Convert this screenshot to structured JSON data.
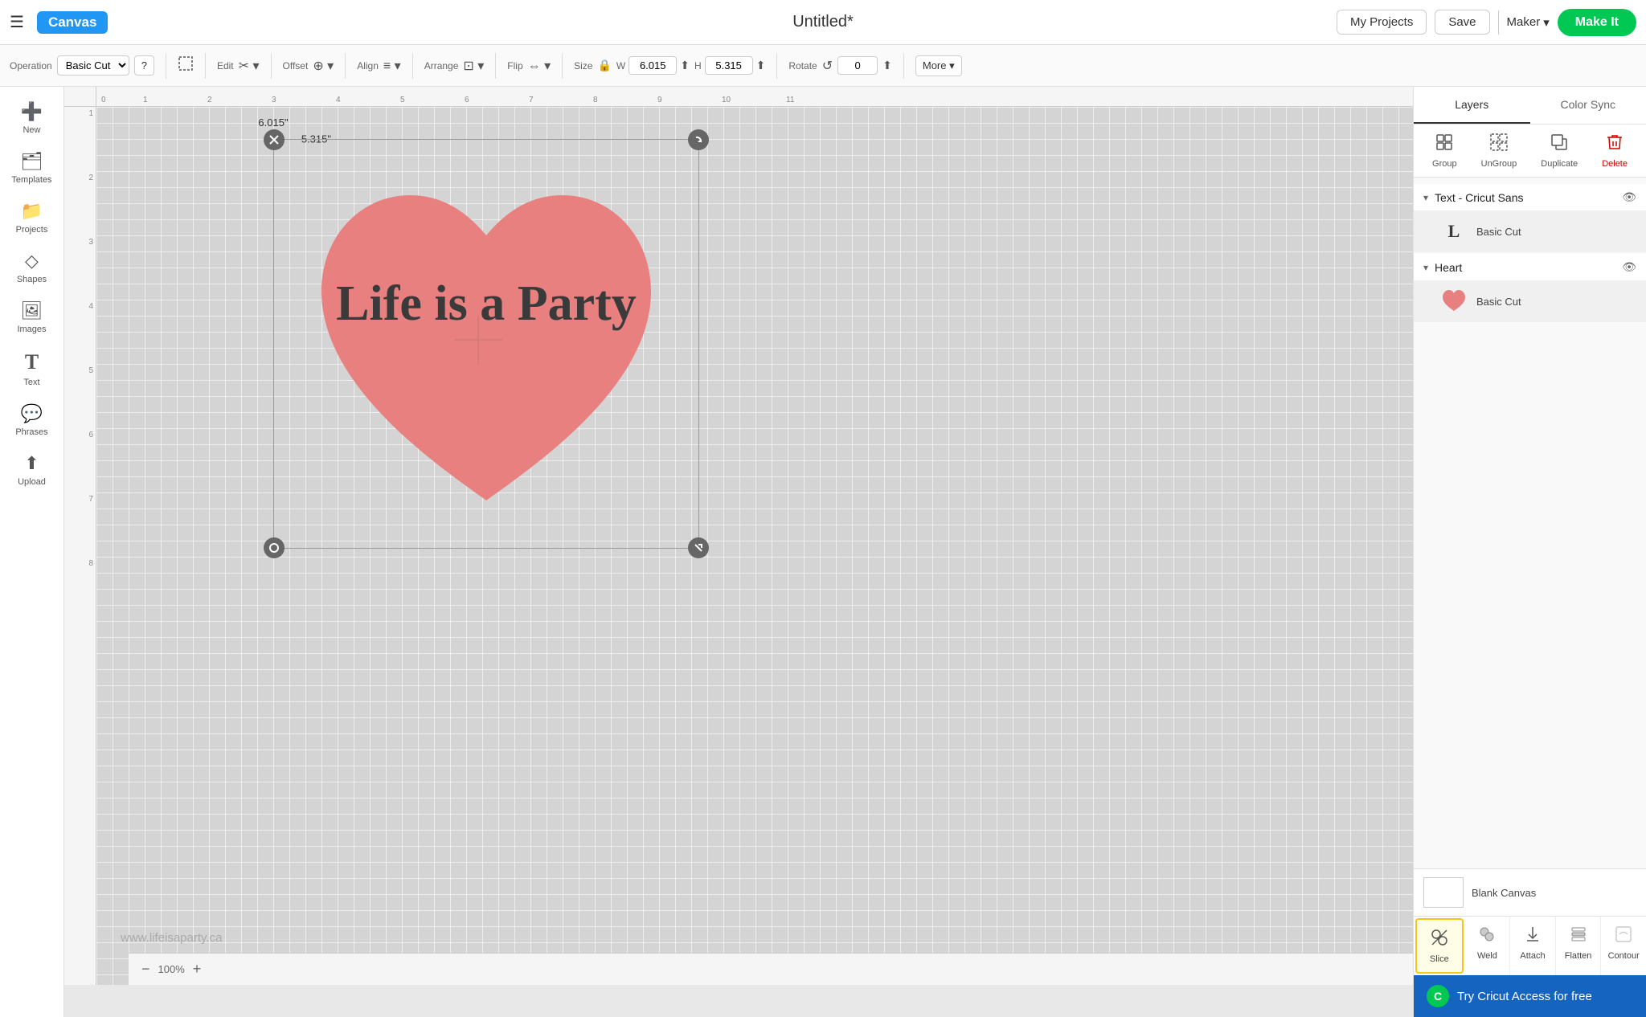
{
  "topbar": {
    "hamburger_label": "☰",
    "canvas_badge": "Canvas",
    "title": "Untitled*",
    "my_projects_label": "My Projects",
    "save_label": "Save",
    "maker_label": "Maker",
    "make_it_label": "Make It"
  },
  "toolbar": {
    "operation_label": "Operation",
    "operation_value": "Basic Cut",
    "help_label": "?",
    "deselect_label": "Deselect",
    "edit_label": "Edit",
    "offset_label": "Offset",
    "align_label": "Align",
    "arrange_label": "Arrange",
    "flip_label": "Flip",
    "size_label": "Size",
    "width_label": "W",
    "width_value": "6.015",
    "height_label": "H",
    "height_value": "5.315",
    "rotate_label": "Rotate",
    "rotate_value": "0",
    "more_label": "More ▾"
  },
  "sidebar": {
    "items": [
      {
        "id": "new",
        "icon": "➕",
        "label": "New"
      },
      {
        "id": "templates",
        "icon": "🗂",
        "label": "Templates"
      },
      {
        "id": "projects",
        "icon": "📁",
        "label": "Projects"
      },
      {
        "id": "shapes",
        "icon": "◇",
        "label": "Shapes"
      },
      {
        "id": "images",
        "icon": "🖼",
        "label": "Images"
      },
      {
        "id": "text",
        "icon": "T",
        "label": "Text"
      },
      {
        "id": "phrases",
        "icon": "💬",
        "label": "Phrases"
      },
      {
        "id": "upload",
        "icon": "⬆",
        "label": "Upload"
      }
    ]
  },
  "canvas": {
    "width_label": "6.015\"",
    "height_label": "5.315\"",
    "heart_text": "Life is a Party",
    "watermark": "www.lifeisaparty.ca",
    "zoom": "100%",
    "ruler_h": [
      "0",
      "1",
      "2",
      "3",
      "4",
      "5",
      "6",
      "7",
      "8",
      "9",
      "10",
      "11"
    ],
    "ruler_v": [
      "1",
      "2",
      "3",
      "4",
      "5",
      "6",
      "7",
      "8"
    ]
  },
  "layers_panel": {
    "tab_layers": "Layers",
    "tab_color_sync": "Color Sync",
    "action_group": "Group",
    "action_ungroup": "UnGroup",
    "action_duplicate": "Duplicate",
    "action_delete": "Delete",
    "groups": [
      {
        "name": "Text - Cricut Sans",
        "items": [
          {
            "op": "Basic Cut",
            "thumb_type": "text"
          }
        ]
      },
      {
        "name": "Heart",
        "items": [
          {
            "op": "Basic Cut",
            "thumb_type": "heart"
          }
        ]
      }
    ]
  },
  "bottom": {
    "blank_canvas_label": "Blank Canvas",
    "slice_label": "Slice",
    "weld_label": "Weld",
    "attach_label": "Attach",
    "flatten_label": "Flatten",
    "contour_label": "Contour",
    "cricut_banner": "Try Cricut Access for free"
  }
}
